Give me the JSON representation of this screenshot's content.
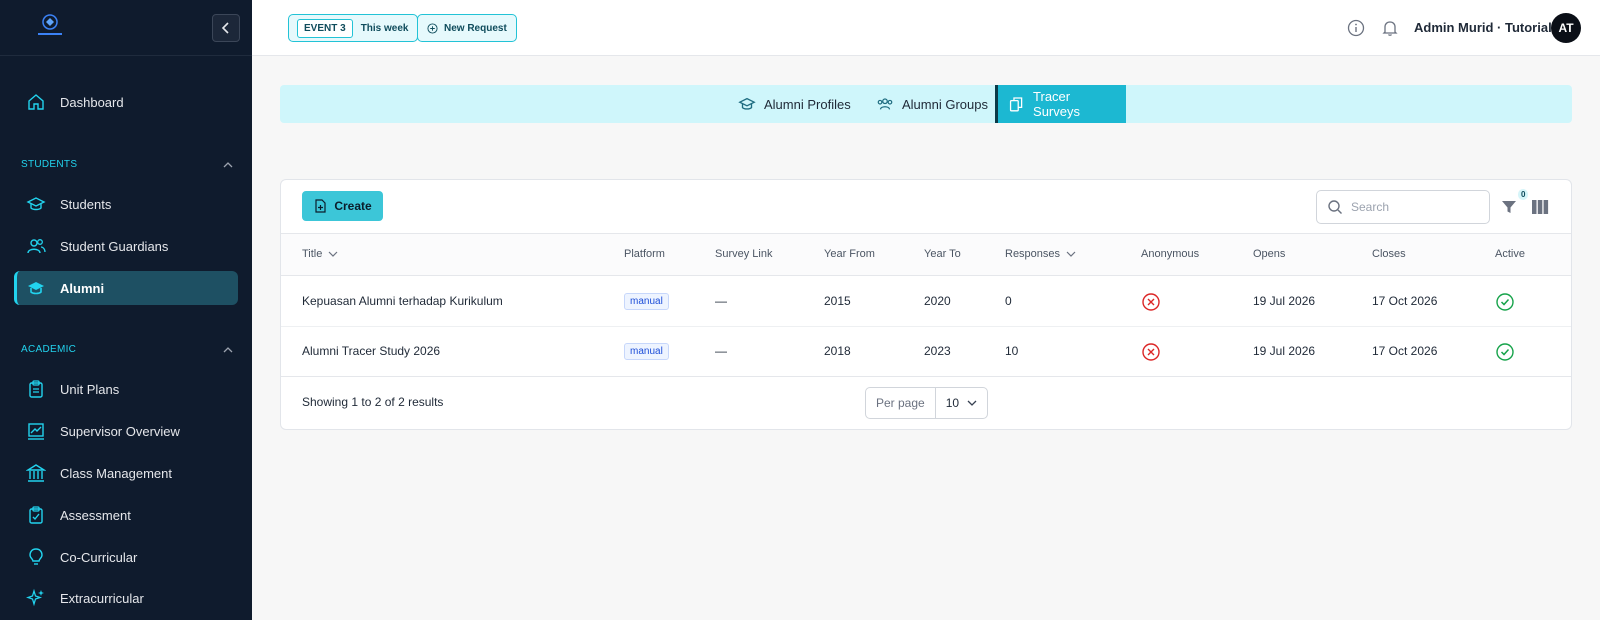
{
  "app": {
    "logo_icon": "school-logo-icon"
  },
  "sidebar": {
    "items_top": [
      {
        "label": "Dashboard",
        "icon": "home-icon"
      }
    ],
    "sections": [
      {
        "title": "STUDENTS",
        "items": [
          {
            "label": "Students",
            "icon": "graduation-cap-icon"
          },
          {
            "label": "Student Guardians",
            "icon": "users-icon"
          },
          {
            "label": "Alumni",
            "icon": "graduation-cap-icon",
            "active": true
          }
        ]
      },
      {
        "title": "ACADEMIC",
        "items": [
          {
            "label": "Unit Plans",
            "icon": "clipboard-icon"
          },
          {
            "label": "Supervisor Overview",
            "icon": "presentation-chart-icon"
          },
          {
            "label": "Class Management",
            "icon": "building-columns-icon"
          },
          {
            "label": "Assessment",
            "icon": "clipboard-check-icon"
          },
          {
            "label": "Co-Curricular",
            "icon": "lightbulb-icon"
          },
          {
            "label": "Extracurricular",
            "icon": "sparkles-icon"
          }
        ]
      }
    ]
  },
  "topbar": {
    "event_tag": "EVENT 3",
    "event_period": "This week",
    "new_request": "New Request",
    "user_name": "Admin Murid · Tutorial",
    "avatar_initials": "AT"
  },
  "tabs": [
    {
      "label": "Alumni Profiles",
      "icon": "graduation-cap-icon"
    },
    {
      "label": "Alumni Groups",
      "icon": "users-group-icon"
    },
    {
      "label": "Tracer Surveys",
      "icon": "documents-icon",
      "active": true
    }
  ],
  "table": {
    "create_label": "Create",
    "search_placeholder": "Search",
    "filter_count": "0",
    "columns": [
      "Title",
      "Platform",
      "Survey Link",
      "Year From",
      "Year To",
      "Responses",
      "Anonymous",
      "Opens",
      "Closes",
      "Active"
    ],
    "rows": [
      {
        "title": "Kepuasan Alumni terhadap Kurikulum",
        "platform": "manual",
        "survey_link": "—",
        "year_from": "2015",
        "year_to": "2020",
        "responses": "0",
        "anonymous": false,
        "opens": "19 Jul 2026",
        "closes": "17 Oct 2026",
        "active": true
      },
      {
        "title": "Alumni Tracer Study 2026",
        "platform": "manual",
        "survey_link": "—",
        "year_from": "2018",
        "year_to": "2023",
        "responses": "10",
        "anonymous": false,
        "opens": "19 Jul 2026",
        "closes": "17 Oct 2026",
        "active": true
      }
    ],
    "summary": "Showing 1 to 2 of 2 results",
    "per_page_label": "Per page",
    "per_page_value": "10"
  },
  "colors": {
    "accent": "#22d3ee",
    "sidebar_bg": "#0f1b2d",
    "danger": "#dc2626",
    "success": "#16a34a"
  }
}
